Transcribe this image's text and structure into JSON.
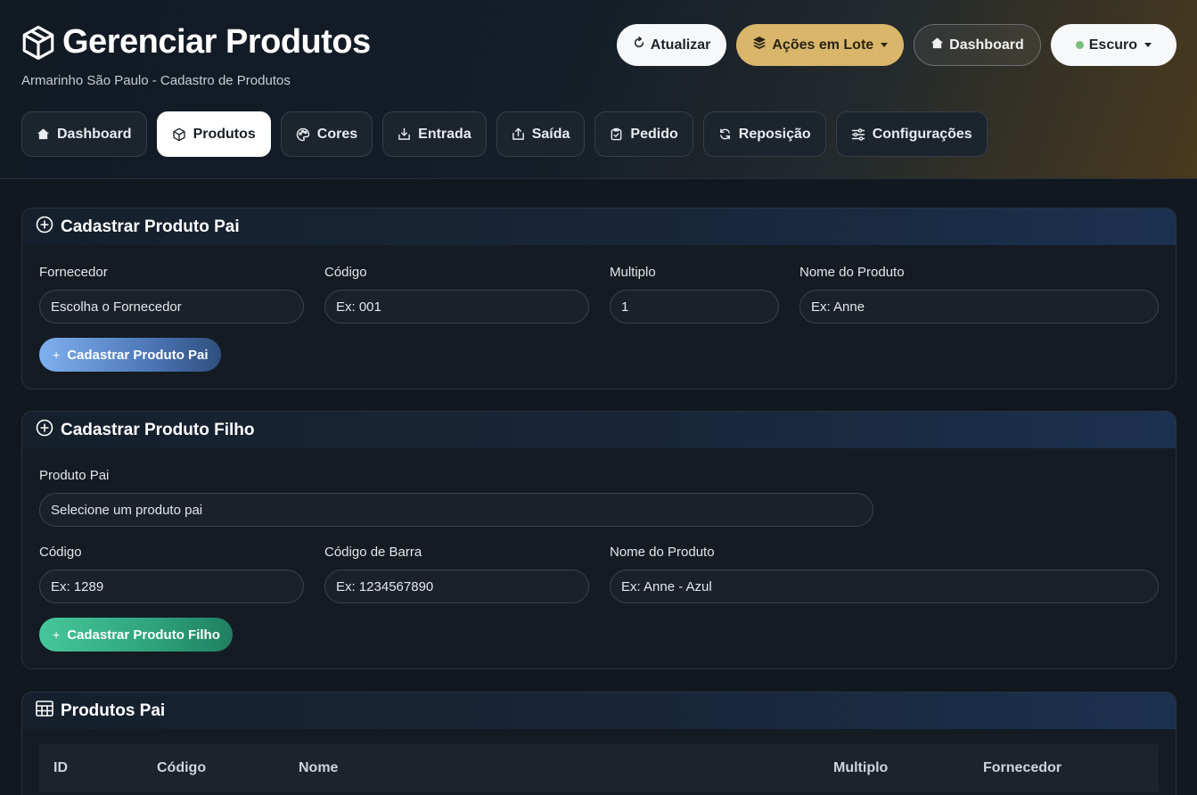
{
  "header": {
    "title": "Gerenciar Produtos",
    "subtitle": "Armarinho São Paulo - Cadastro de Produtos",
    "title_icon": "box-icon"
  },
  "top_actions": {
    "refresh": "Atualizar",
    "batch": "Ações em Lote",
    "dashboard": "Dashboard",
    "theme": "Escuro"
  },
  "tabs": [
    {
      "label": "Dashboard",
      "icon": "house-icon",
      "active": false
    },
    {
      "label": "Produtos",
      "icon": "box-icon",
      "active": true
    },
    {
      "label": "Cores",
      "icon": "palette-icon",
      "active": false
    },
    {
      "label": "Entrada",
      "icon": "inbox-in-icon",
      "active": false
    },
    {
      "label": "Saída",
      "icon": "box-out-icon",
      "active": false
    },
    {
      "label": "Pedido",
      "icon": "clipboard-check-icon",
      "active": false
    },
    {
      "label": "Reposição",
      "icon": "refresh-icon",
      "active": false
    },
    {
      "label": "Configurações",
      "icon": "sliders-icon",
      "active": false
    }
  ],
  "parent_form": {
    "title": "Cadastrar Produto Pai",
    "fornecedor_label": "Fornecedor",
    "fornecedor_value": "Escolha o Fornecedor",
    "codigo_label": "Código",
    "codigo_placeholder": "Ex: 001",
    "multiplo_label": "Multiplo",
    "multiplo_value": "1",
    "nome_label": "Nome do Produto",
    "nome_placeholder": "Ex: Anne",
    "submit": "Cadastrar Produto Pai"
  },
  "child_form": {
    "title": "Cadastrar Produto Filho",
    "pai_label": "Produto Pai",
    "pai_value": "Selecione um produto pai",
    "codigo_label": "Código",
    "codigo_placeholder": "Ex: 1289",
    "barra_label": "Código de Barra",
    "barra_placeholder": "Ex: 1234567890",
    "nome_label": "Nome do Produto",
    "nome_placeholder": "Ex: Anne - Azul",
    "submit": "Cadastrar Produto Filho"
  },
  "parent_table": {
    "title": "Produtos Pai",
    "columns": [
      "ID",
      "Código",
      "Nome",
      "Multiplo",
      "Fornecedor"
    ]
  },
  "colors": {
    "accent_gold": "#d9b66a",
    "accent_blue": "#4d77b8",
    "accent_green": "#2ea27b",
    "theme_dot": "#7bbf7e"
  }
}
